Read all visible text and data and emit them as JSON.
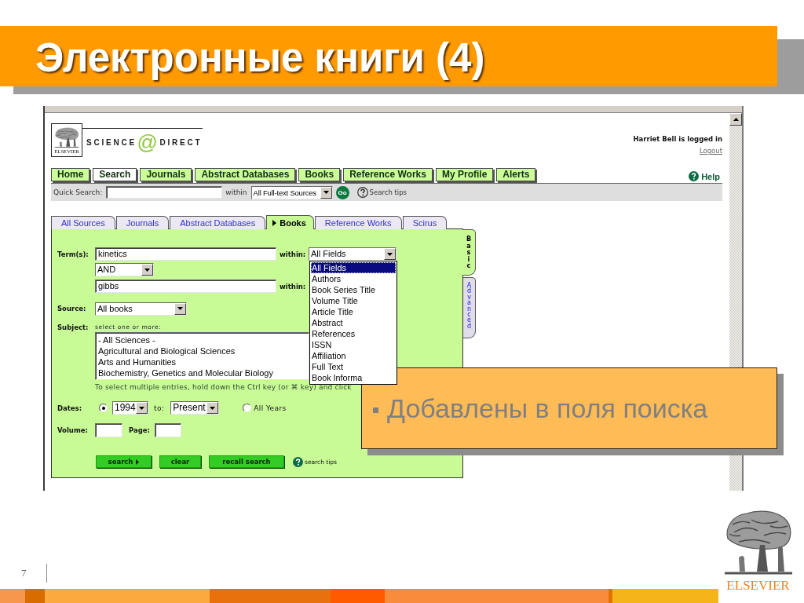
{
  "slide": {
    "title": "Электронные книги (4)",
    "page_number": "7",
    "publisher_logo": "ELSEVIER"
  },
  "browser": {
    "logo": {
      "publisher": "ELSEVIER",
      "name_left": "SCIENCE",
      "symbol": "@",
      "name_right": "DIRECT"
    },
    "user_status": "Harriet Bell is logged in",
    "logout": "Logout",
    "nav_tabs": [
      {
        "label": "Home",
        "selected": false
      },
      {
        "label": "Search",
        "selected": true
      },
      {
        "label": "Journals",
        "selected": false
      },
      {
        "label": "Abstract Databases",
        "selected": false
      },
      {
        "label": "Books",
        "selected": false
      },
      {
        "label": "Reference Works",
        "selected": false
      },
      {
        "label": "My Profile",
        "selected": false
      },
      {
        "label": "Alerts",
        "selected": false
      }
    ],
    "help": "Help",
    "quick_search": {
      "label": "Quick Search:",
      "within_label": "within",
      "source": "All Full-text Sources",
      "go": "Go",
      "tips": "Search tips"
    },
    "source_tabs": [
      {
        "label": "All Sources",
        "selected": false
      },
      {
        "label": "Journals",
        "selected": false
      },
      {
        "label": "Abstract Databases",
        "selected": false
      },
      {
        "label": "Books",
        "selected": true
      },
      {
        "label": "Reference Works",
        "selected": false
      },
      {
        "label": "Scirus",
        "selected": false
      }
    ],
    "mode_tabs": [
      {
        "label": "Basic",
        "selected": true
      },
      {
        "label": "Advanced",
        "selected": false
      }
    ],
    "form": {
      "terms_label": "Term(s):",
      "terms": [
        {
          "value": "kinetics",
          "within_label": "within:",
          "field": "All Fields",
          "expanded": true,
          "options": [
            {
              "label": "All Fields",
              "selected": true
            },
            {
              "label": "Authors",
              "selected": false
            },
            {
              "label": "Book Series Title",
              "selected": false
            },
            {
              "label": "Volume Title",
              "selected": false
            },
            {
              "label": "Article Title",
              "selected": false
            },
            {
              "label": "Abstract",
              "selected": false
            },
            {
              "label": "References",
              "selected": false
            },
            {
              "label": "ISSN",
              "selected": false
            },
            {
              "label": "Affiliation",
              "selected": false
            },
            {
              "label": "Full Text",
              "selected": false
            },
            {
              "label": "Book Informa",
              "selected": false
            }
          ]
        },
        {
          "value": "gibbs",
          "within_label": "within:"
        }
      ],
      "operator": "AND",
      "source_label": "Source:",
      "source": "All books",
      "subject_label": "Subject:",
      "subject_hint": "select one or more:",
      "subjects": [
        {
          "label": "- All Sciences -",
          "selected": false
        },
        {
          "label": "Agricultural and Biological Sciences",
          "selected": false
        },
        {
          "label": "Arts and Humanities",
          "selected": false
        },
        {
          "label": "Biochemistry, Genetics and Molecular Biology",
          "selected": false
        }
      ],
      "multi_select_note": "To select multiple entries, hold down the Ctrl key (or ⌘ key) and click",
      "dates_label": "Dates:",
      "date_options": [
        {
          "kind": "range",
          "selected": true,
          "from": "1994",
          "to_label": "to:",
          "to": "Present"
        },
        {
          "kind": "all",
          "selected": false,
          "label": "All Years"
        }
      ],
      "volume_label": "Volume:",
      "page_label": "Page:",
      "buttons": [
        {
          "label": "search",
          "kind": "submit"
        },
        {
          "label": "clear",
          "kind": "plain"
        },
        {
          "label": "recall search",
          "kind": "plain"
        }
      ],
      "search_tips": "search tips"
    }
  },
  "callout": {
    "text": "Добавлены в поля поиска"
  }
}
